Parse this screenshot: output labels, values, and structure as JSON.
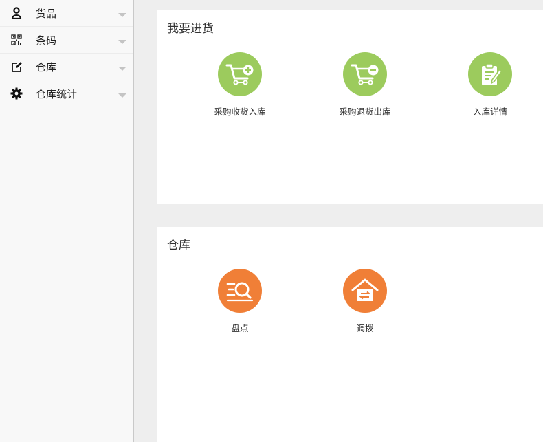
{
  "sidebar": {
    "items": [
      {
        "label": "货品",
        "icon": "user-icon"
      },
      {
        "label": "条码",
        "icon": "qrcode-icon"
      },
      {
        "label": "仓库",
        "icon": "edit-icon"
      },
      {
        "label": "仓库统计",
        "icon": "gear-icon"
      }
    ]
  },
  "purchase": {
    "title": "我要进货",
    "tiles": [
      {
        "label": "采购收货入库",
        "icon": "cart-add-icon",
        "color": "#9ccb5d"
      },
      {
        "label": "采购退货出库",
        "icon": "cart-remove-icon",
        "color": "#9ccb5d"
      },
      {
        "label": "入库详情",
        "icon": "clipboard-edit-icon",
        "color": "#9ccb5d"
      }
    ]
  },
  "warehouse": {
    "title": "仓库",
    "tiles": [
      {
        "label": "盘点",
        "icon": "stocktake-search-icon",
        "color": "#f07f37"
      },
      {
        "label": "调拨",
        "icon": "transfer-house-icon",
        "color": "#f07f37"
      }
    ]
  }
}
